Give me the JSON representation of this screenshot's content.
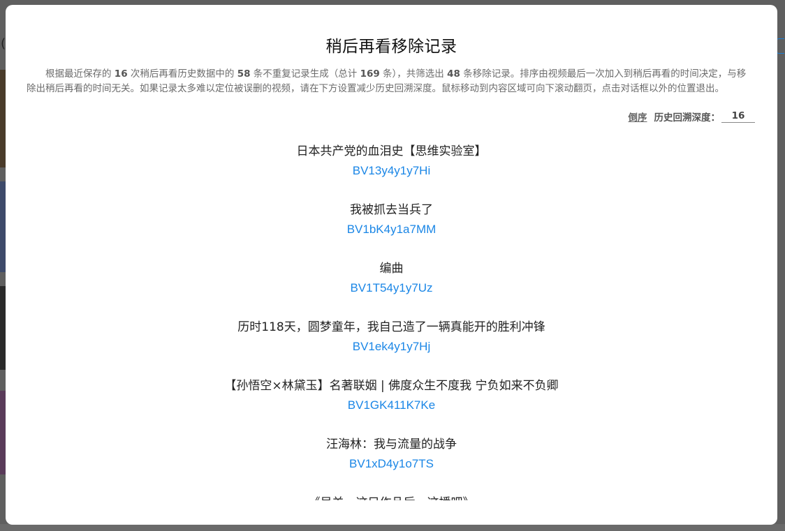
{
  "modal": {
    "title": "稍后再看移除记录",
    "description": {
      "p1": "根据最近保存的 ",
      "n1": "16",
      "p2": " 次稍后再看历史数据中的 ",
      "n2": "58",
      "p3": " 条不重复记录生成（总计 ",
      "n3": "169",
      "p4": " 条），共筛选出 ",
      "n4": "48",
      "p5": " 条移除记录。排序由视频最后一次加入到稍后再看的时间决定，与移除出稍后再看的时间无关。如果记录太多难以定位被误删的视频，请在下方设置减少历史回溯深度。鼠标移动到内容区域可向下滚动翻页，点击对话框以外的位置退出。"
    },
    "sort_label": "倒序",
    "depth_label": "历史回溯深度：",
    "depth_value": "16"
  },
  "records": [
    {
      "title": "日本共产党的血泪史【思维实验室】",
      "bvid": "BV13y4y1y7Hi"
    },
    {
      "title": "我被抓去当兵了",
      "bvid": "BV1bK4y1a7MM"
    },
    {
      "title": "编曲",
      "bvid": "BV1T54y1y7Uz"
    },
    {
      "title": "历时118天，圆梦童年，我自己造了一辆真能开的胜利冲锋",
      "bvid": "BV1ek4y1y7Hj"
    },
    {
      "title": "【孙悟空×林黛玉】名著联姻 | 佛度众生不度我 宁负如来不负卿",
      "bvid": "BV1GK411K7Ke"
    },
    {
      "title": "汪海林：我与流量的战争",
      "bvid": "BV1xD4y1o7TS"
    },
    {
      "title": "《吴羊，这只作品后，这播吧》",
      "bvid": ""
    }
  ],
  "background": {
    "left_glyph": "(",
    "colors": {
      "link": "#1a86e6",
      "overlay": "#5f5f5f"
    }
  }
}
